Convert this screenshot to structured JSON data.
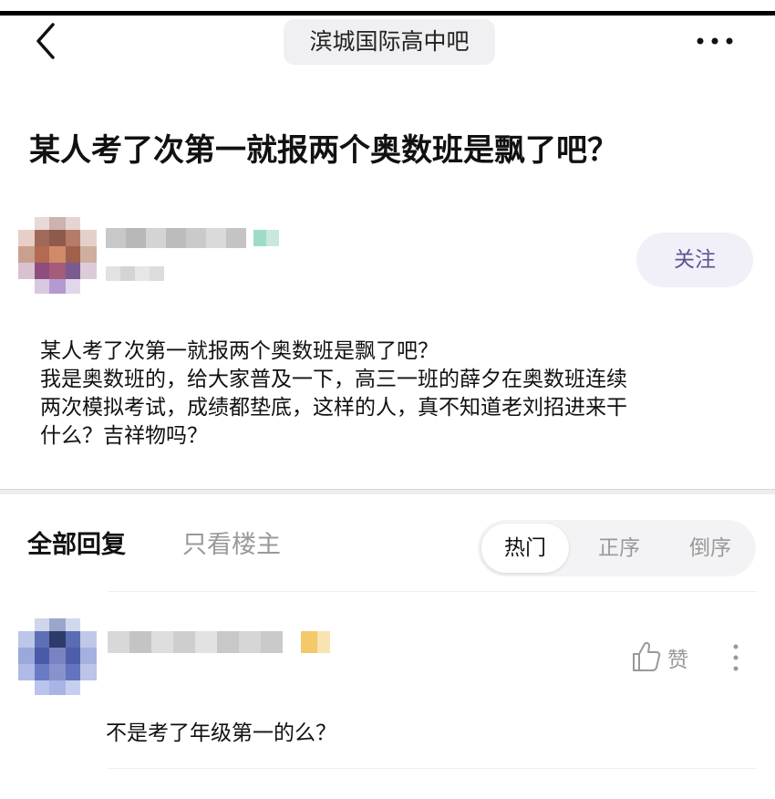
{
  "nav": {
    "back_icon": "chevron-left-icon",
    "forum_name": "滨城国际高中吧",
    "more_icon": "more-dots-icon"
  },
  "post": {
    "title": "某人考了次第一就报两个奥数班是飘了吧？",
    "follow_label": "关注",
    "body_lines": [
      "某人考了次第一就报两个奥数班是飘了吧？",
      "我是奥数班的，给大家普及一下，高三一班的薛夕在奥数班连续",
      "两次模拟考试，成绩都垫底，这样的人，真不知道老刘招进来干",
      "什么？吉祥物吗？"
    ]
  },
  "replies_header": {
    "all_label": "全部回复",
    "op_only_label": "只看楼主",
    "sort_hot": "热门",
    "sort_asc": "正序",
    "sort_desc": "倒序"
  },
  "reply": {
    "like_label": "赞",
    "text": "不是考了年级第一的么？"
  },
  "colors": {
    "follow_text": "#5a5690",
    "follow_bg": "#f1f0f8",
    "muted_text": "#999999"
  }
}
